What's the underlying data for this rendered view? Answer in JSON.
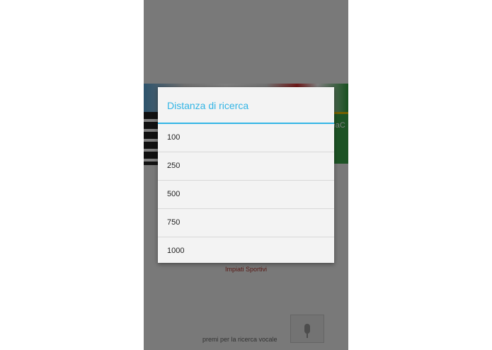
{
  "app": {
    "banner_partial_text": "reaC",
    "sports_label": "Impiati Sportivi",
    "voice_hint": "premi per la ricerca vocale",
    "mic_icon": "microphone-icon"
  },
  "dialog": {
    "title": "Distanza di ricerca",
    "options": [
      "100",
      "250",
      "500",
      "750",
      "1000"
    ]
  },
  "colors": {
    "accent": "#33b5e5",
    "sports_text": "#b0342c"
  }
}
